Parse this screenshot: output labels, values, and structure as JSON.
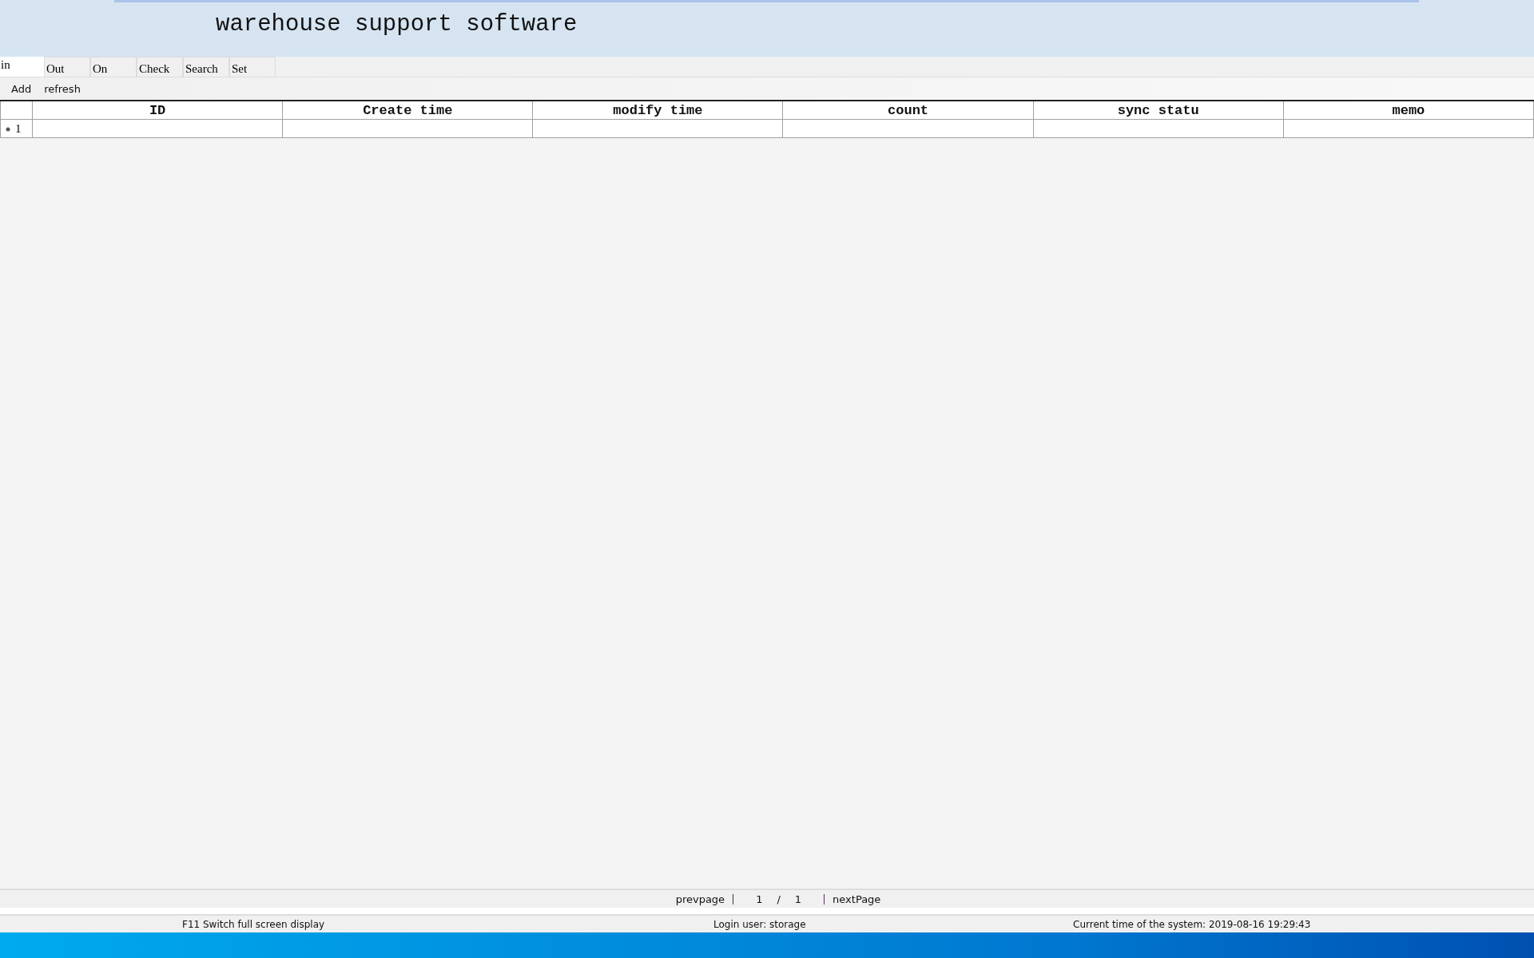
{
  "window": {
    "title": "warehouse support software"
  },
  "tabs": [
    {
      "label": "in",
      "selected": true
    },
    {
      "label": "Out",
      "selected": false
    },
    {
      "label": "On",
      "selected": false
    },
    {
      "label": "Check",
      "selected": false
    },
    {
      "label": "Search",
      "selected": false
    },
    {
      "label": "Set",
      "selected": false
    }
  ],
  "toolbar": [
    "Add",
    "refresh"
  ],
  "table": {
    "columns": [
      "ID",
      "Create time",
      "modify time",
      "count",
      "sync statu",
      "memo"
    ],
    "rows": [
      {
        "number": "1",
        "new_row": true
      }
    ]
  },
  "pager": {
    "prev": "prevpage",
    "current": "1",
    "separator": "/",
    "total": "1",
    "next": "nextPage"
  },
  "status_bar": {
    "hint": "F11 Switch full screen display",
    "user": "Login user:  storage",
    "time": "Current time of the system:  2019-08-16 19:29:43"
  }
}
